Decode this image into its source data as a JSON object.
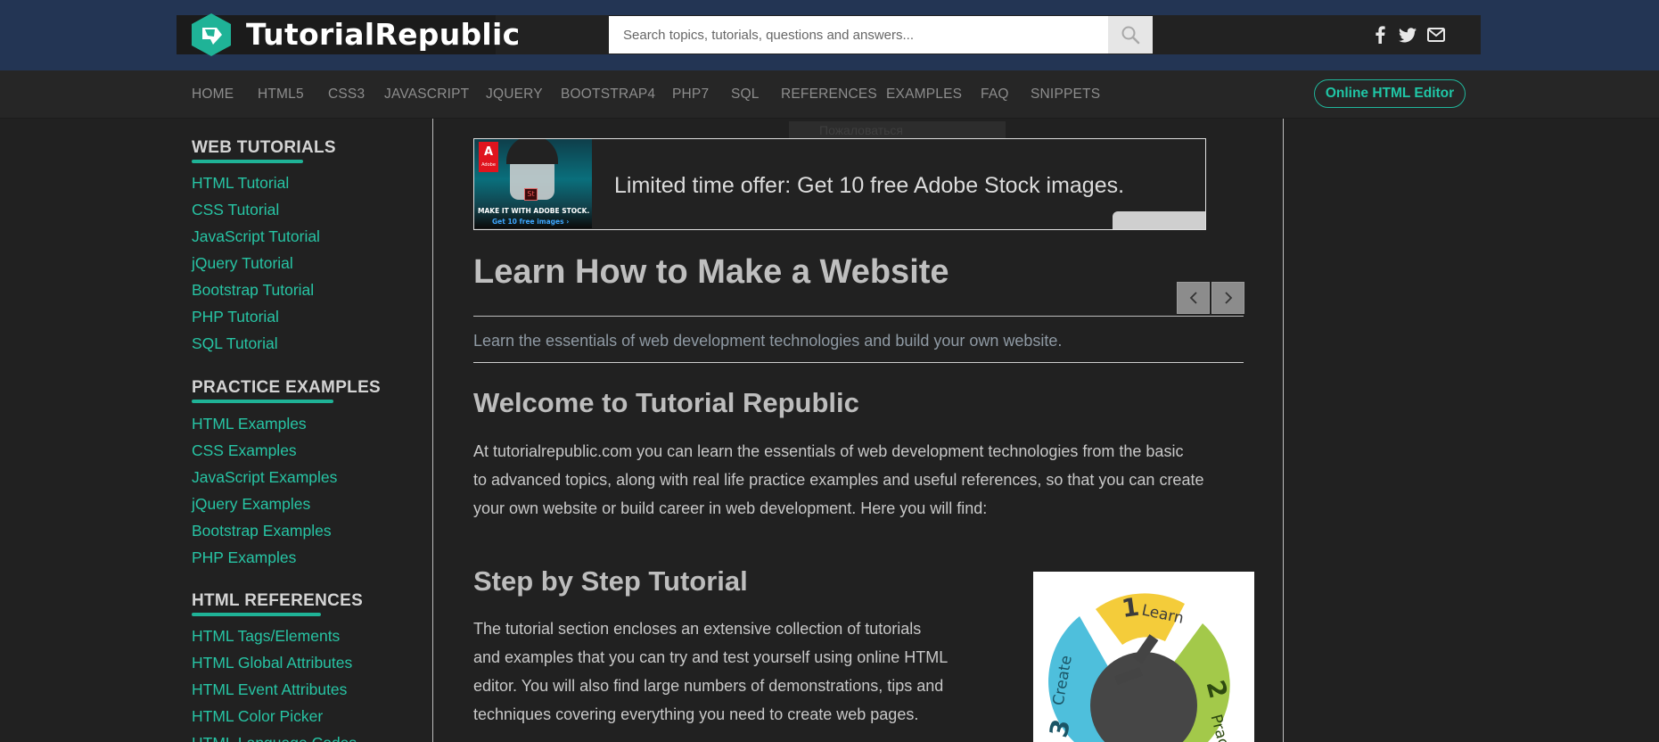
{
  "header": {
    "logo_text": "TutorialRepublic",
    "search": {
      "placeholder": "Search topics, tutorials, questions and answers..."
    },
    "social_icons": [
      "facebook-icon",
      "twitter-icon",
      "mail-icon"
    ]
  },
  "nav": {
    "items": [
      "HOME",
      "HTML5",
      "CSS3",
      "JAVASCRIPT",
      "JQUERY",
      "BOOTSTRAP4",
      "PHP7",
      "SQL",
      "REFERENCES",
      "EXAMPLES",
      "FAQ",
      "SNIPPETS"
    ],
    "editor_button": "Online HTML Editor"
  },
  "sidebar": {
    "sections": [
      {
        "heading": "WEB TUTORIALS",
        "links": [
          "HTML Tutorial",
          "CSS Tutorial",
          "JavaScript Tutorial",
          "jQuery Tutorial",
          "Bootstrap Tutorial",
          "PHP Tutorial",
          "SQL Tutorial"
        ]
      },
      {
        "heading": "PRACTICE EXAMPLES",
        "links": [
          "HTML Examples",
          "CSS Examples",
          "JavaScript Examples",
          "jQuery Examples",
          "Bootstrap Examples",
          "PHP Examples"
        ]
      },
      {
        "heading": "HTML REFERENCES",
        "links": [
          "HTML Tags/Elements",
          "HTML Global Attributes",
          "HTML Event Attributes",
          "HTML Color Picker",
          "HTML Language Codes"
        ]
      }
    ]
  },
  "ad": {
    "tag": "Пожаловаться",
    "text": "Limited time offer: Get 10 free Adobe Stock images.",
    "image_caption": "MAKE IT WITH ADOBE STOCK.",
    "image_sub": "Get 10 free images ›",
    "brand": "Adobe",
    "badge": "St"
  },
  "main": {
    "title": "Learn How to Make a Website",
    "lead": "Learn the essentials of web development technologies and build your own website.",
    "welcome_heading": "Welcome to Tutorial Republic",
    "welcome_lines": [
      "At tutorialrepublic.com you can learn the essentials of web development technologies from the basic",
      "to advanced topics, along with real life practice examples and useful references, so that you can create",
      "your own website or build career in web development. Here you will find:"
    ],
    "step_heading": "Step by Step Tutorial",
    "step_lines": [
      "The tutorial section encloses an extensive collection of tutorials",
      "and examples that you can try and test yourself using online HTML",
      "editor. You will also find large numbers of demonstrations, tips and",
      "techniques covering everything you need to create web pages."
    ],
    "cycle_labels": {
      "learn": "Learn",
      "practice": "Practice",
      "create": "Create",
      "n1": "1",
      "n2": "2",
      "n3": "3"
    }
  },
  "colors": {
    "accent": "#1fb397",
    "header_bg": "#233554",
    "page_bg": "#212121"
  }
}
